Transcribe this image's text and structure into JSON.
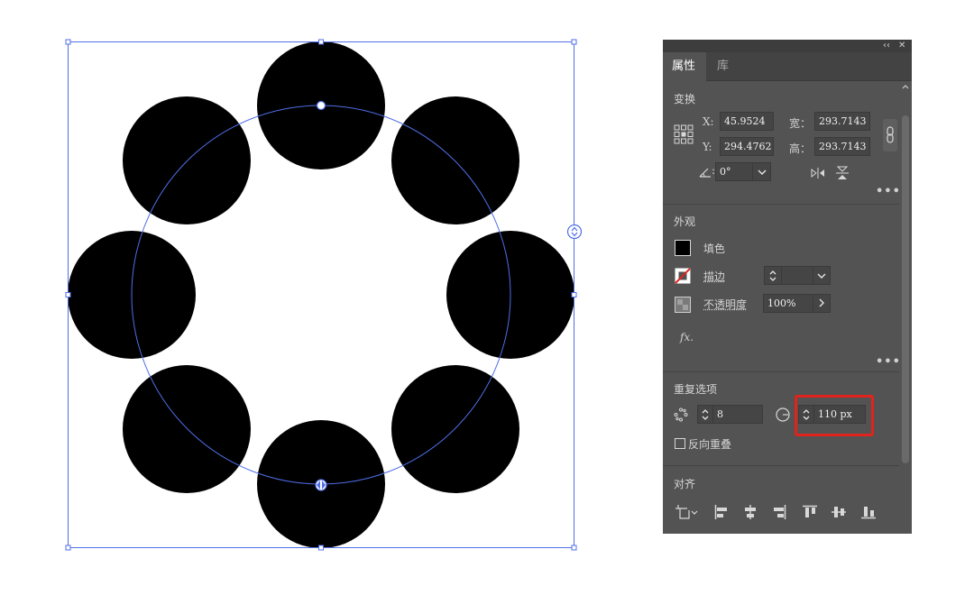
{
  "panel": {
    "tabs": [
      {
        "label": "属性"
      },
      {
        "label": "库"
      }
    ],
    "transform": {
      "title": "变换",
      "x_label": "X:",
      "x_value": "45.9524",
      "y_label": "Y:",
      "y_value": "294.4762",
      "width_label": "宽：",
      "width_value": "293.7143",
      "height_label": "高：",
      "height_value": "293.7143",
      "angle_value": "0°"
    },
    "appearance": {
      "title": "外观",
      "fill_label": "填色",
      "stroke_label": "描边",
      "opacity_label": "不透明度",
      "opacity_value": "100%",
      "fx_label": "fx."
    },
    "repeat": {
      "title": "重复选项",
      "instances_value": "8",
      "radius_value": "110 px",
      "reverse_overlap_label": "反向重叠"
    },
    "align": {
      "title": "对齐"
    }
  },
  "colors": {
    "panel_bg": "#535353",
    "selection": "#4f6ee8",
    "highlight": "#e0231c",
    "fill": "#000000"
  }
}
